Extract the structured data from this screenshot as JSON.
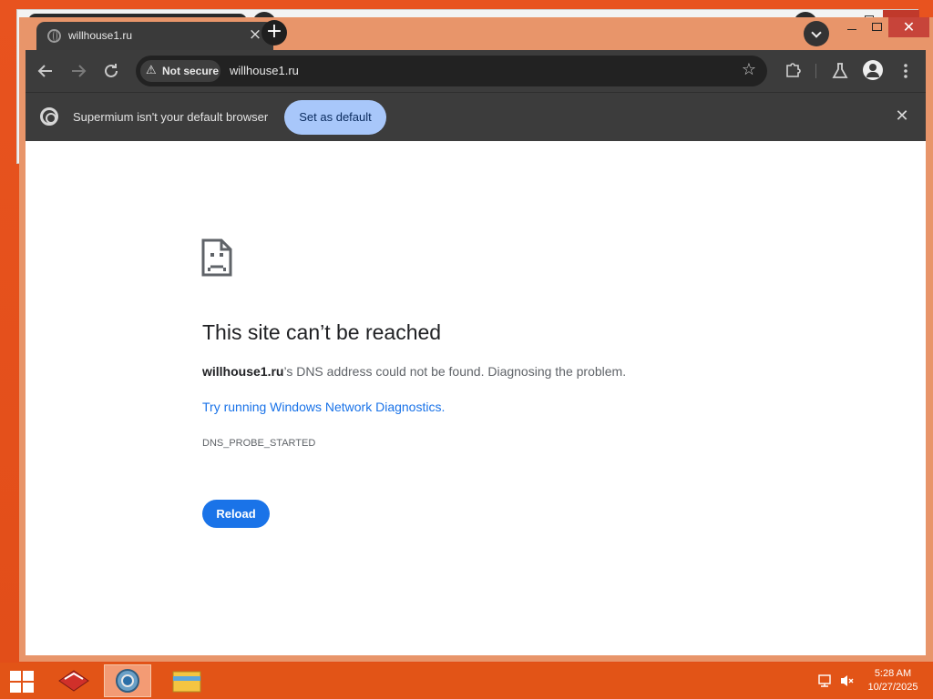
{
  "browser": {
    "tab_title": "willhouse1.ru",
    "new_tab_label": "+",
    "url": "willhouse1.ru",
    "security_chip": "Not secure"
  },
  "infobar": {
    "message": "Supermium isn't your default browser",
    "set_default_label": "Set as default"
  },
  "error_page": {
    "title": "This site can’t be reached",
    "host": "willhouse1.ru",
    "description_rest": "’s DNS address could not be found. Diagnosing the problem.",
    "link_text": "Try running Windows Network Diagnostics.",
    "error_code": "DNS_PROBE_STARTED",
    "reload_label": "Reload"
  },
  "taskbar": {
    "time": "5:28 AM",
    "date": "10/27/2025"
  },
  "icons": {
    "tab_favicon": "globe-icon",
    "tab_close": "close-icon",
    "back": "back-arrow-icon",
    "forward": "forward-arrow-icon",
    "reload": "reload-icon",
    "warning": "warning-icon",
    "bookmark": "star-icon",
    "extensions": "puzzle-icon",
    "labs": "flask-icon",
    "profile": "profile-icon",
    "menu": "kebab-menu-icon",
    "sad_page": "sad-page-icon"
  },
  "colors": {
    "desktop_bg": "#e8531f",
    "window_frame": "#e8956a",
    "toolbar_bg": "#3c3c3c",
    "set_default_bg": "#a8c7fa",
    "link_color": "#1a73e8",
    "reload_button_bg": "#1a73e8"
  }
}
